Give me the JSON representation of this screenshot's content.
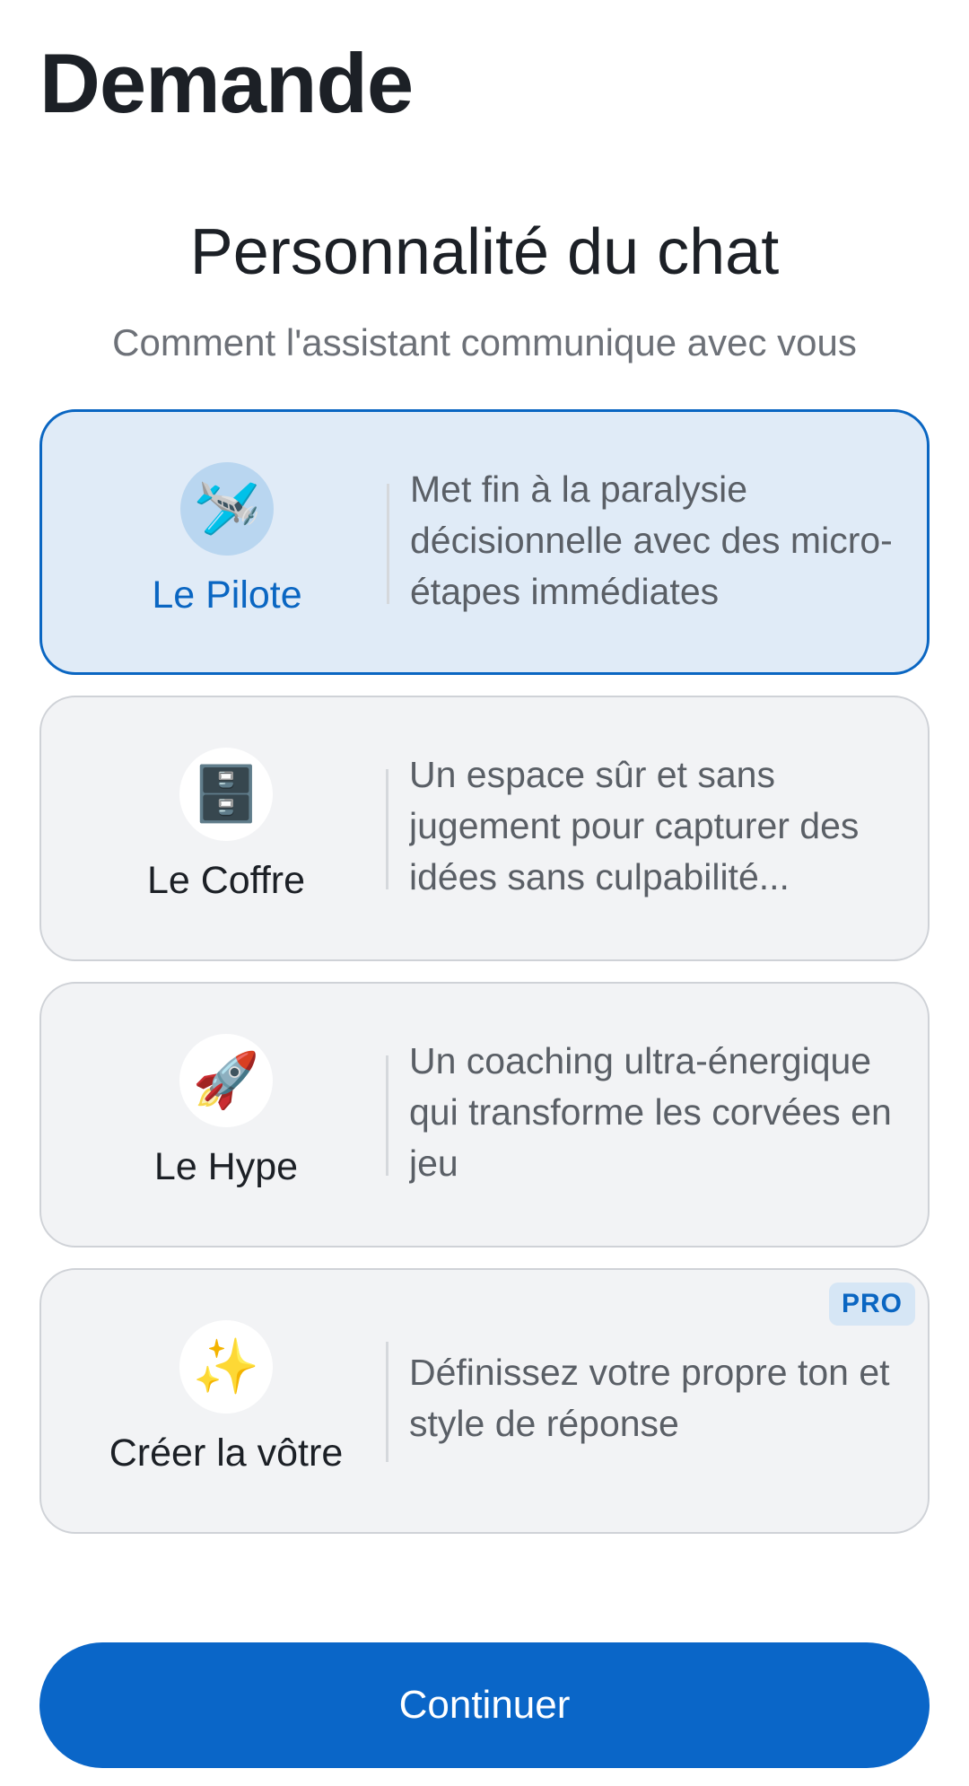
{
  "app_title": "Demande",
  "section": {
    "title": "Personnalité du chat",
    "subtitle": "Comment l'assistant communique avec vous"
  },
  "options": [
    {
      "name": "Le Pilote",
      "icon": "airplane-icon",
      "emoji": "🛩️",
      "description": "Met fin à la paralysie décisionnelle avec des micro-étapes immédiates",
      "selected": true
    },
    {
      "name": "Le Coffre",
      "icon": "file-cabinet-icon",
      "emoji": "🗄️",
      "description": "Un espace sûr et sans jugement pour capturer des idées sans culpabilité...",
      "selected": false
    },
    {
      "name": "Le Hype",
      "icon": "rocket-icon",
      "emoji": "🚀",
      "description": "Un coaching ultra-énergique qui transforme les corvées en jeu",
      "selected": false
    },
    {
      "name": "Créer la vôtre",
      "icon": "sparkles-icon",
      "emoji": "✨",
      "description": "Définissez votre propre ton et style de réponse",
      "badge": "PRO",
      "selected": false
    }
  ],
  "colors": {
    "accent": "#0a66c2",
    "selected_background": "#e0ebf7",
    "card_background": "#f2f3f5"
  },
  "continue_button": {
    "label": "Continuer"
  }
}
